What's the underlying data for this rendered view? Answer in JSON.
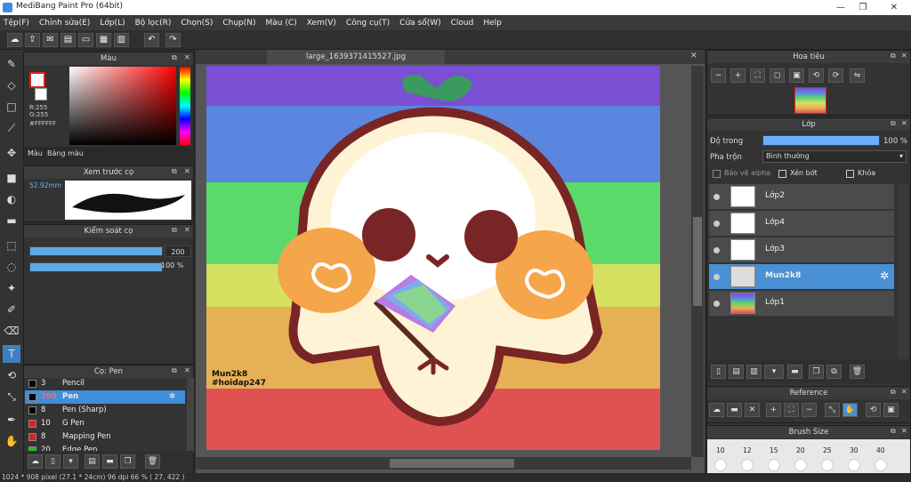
{
  "window": {
    "title": "MediBang Paint Pro (64bit)",
    "minimize": "—",
    "restore": "❐",
    "close": "✕"
  },
  "menu": [
    "Tệp(F)",
    "Chỉnh sửa(E)",
    "Lớp(L)",
    "Bộ lọc(R)",
    "Chọn(S)",
    "Chụp(N)",
    "Màu (C)",
    "Xem(V)",
    "Công cụ(T)",
    "Cửa sổ(W)",
    "Cloud",
    "Help"
  ],
  "toolbar_icons": [
    "cloud-icon",
    "upload-icon",
    "chat-icon",
    "book-icon",
    "document-icon",
    "grid-icon",
    "panel-icon",
    "undo-icon",
    "redo-icon"
  ],
  "color_panel": {
    "title": "Màu",
    "r": "R:255",
    "g": "G:255",
    "hex": "#FFFFFF",
    "tabs": [
      "Màu",
      "Bảng màu"
    ],
    "accent": "#d62020"
  },
  "brush_preview": {
    "title": "Xem trước cọ",
    "size": "52.92mm"
  },
  "brush_control": {
    "title": "Kiểm soát cọ",
    "size": "200",
    "opacity": "100 %"
  },
  "pen_list": {
    "title": "Cọ: Pen",
    "items": [
      {
        "size": "3",
        "name": "Pencil",
        "color": "#000000",
        "selected": false
      },
      {
        "size": "200",
        "name": "Pen",
        "color": "#000000",
        "selected": true
      },
      {
        "size": "8",
        "name": "Pen (Sharp)",
        "color": "#000000",
        "selected": false
      },
      {
        "size": "10",
        "name": "G Pen",
        "color": "#e02020",
        "selected": false
      },
      {
        "size": "8",
        "name": "Mapping Pen",
        "color": "#e02020",
        "selected": false
      },
      {
        "size": "20",
        "name": "Edge Pen",
        "color": "#20c020",
        "selected": false
      }
    ]
  },
  "canvas": {
    "filename": "large_1639371415527.jpg",
    "watermark_line1": "Mun2k8",
    "watermark_line2": "#hoidap247"
  },
  "navigator": {
    "title": "Hoa tiêu"
  },
  "layers": {
    "title": "Lớp",
    "opacity_label": "Độ trong",
    "opacity_value": "100 %",
    "blend_label": "Pha trộn",
    "blend_value": "Bình thường",
    "protect_alpha": "Bảo vệ alpha",
    "clipping": "Xén bớt",
    "lock": "Khóa",
    "items": [
      {
        "name": "Lớp2",
        "selected": false
      },
      {
        "name": "Lớp4",
        "selected": false
      },
      {
        "name": "Lớp3",
        "selected": false
      },
      {
        "name": "Mun2k8",
        "selected": true
      },
      {
        "name": "Lớp1",
        "selected": false
      }
    ]
  },
  "reference": {
    "title": "Reference"
  },
  "brush_size": {
    "title": "Brush Size",
    "sizes": [
      "10",
      "12",
      "15",
      "20",
      "25",
      "30",
      "40"
    ]
  },
  "status": {
    "text": "1024 * 908 pixel   (27.1 * 24cm)   96 dpi   66 %   ( 27, 422 )"
  }
}
